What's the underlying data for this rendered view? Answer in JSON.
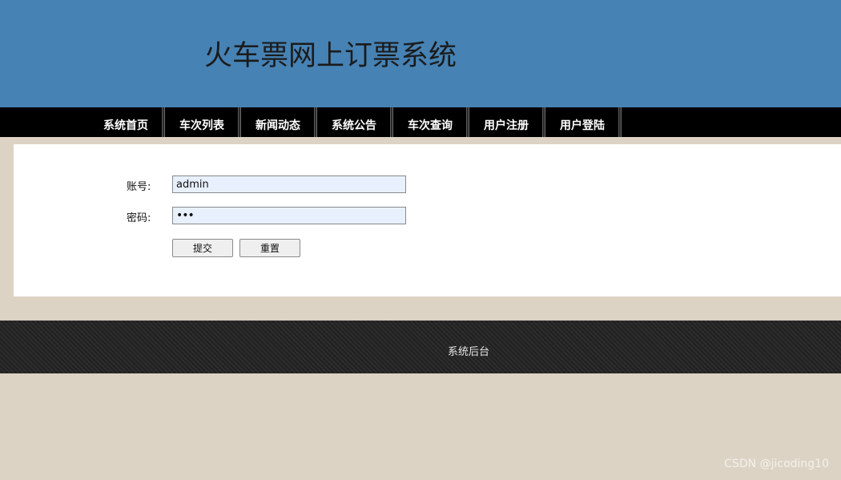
{
  "header": {
    "title": "火车票网上订票系统",
    "background_color": "#4682b4"
  },
  "nav": {
    "items": [
      {
        "label": "系统首页"
      },
      {
        "label": "车次列表"
      },
      {
        "label": "新闻动态"
      },
      {
        "label": "系统公告"
      },
      {
        "label": "车次查询"
      },
      {
        "label": "用户注册"
      },
      {
        "label": "用户登陆"
      }
    ]
  },
  "login_form": {
    "username_label": "账号:",
    "username_value": "admin",
    "password_label": "密码:",
    "password_value": "•••",
    "submit_label": "提交",
    "reset_label": "重置"
  },
  "footer": {
    "admin_link": "系统后台"
  },
  "watermark": "CSDN @jicoding10",
  "colors": {
    "page_background": "#dcd3c5",
    "nav_background": "#000000",
    "input_background": "#e8f0fe",
    "footer_background": "#262626"
  }
}
